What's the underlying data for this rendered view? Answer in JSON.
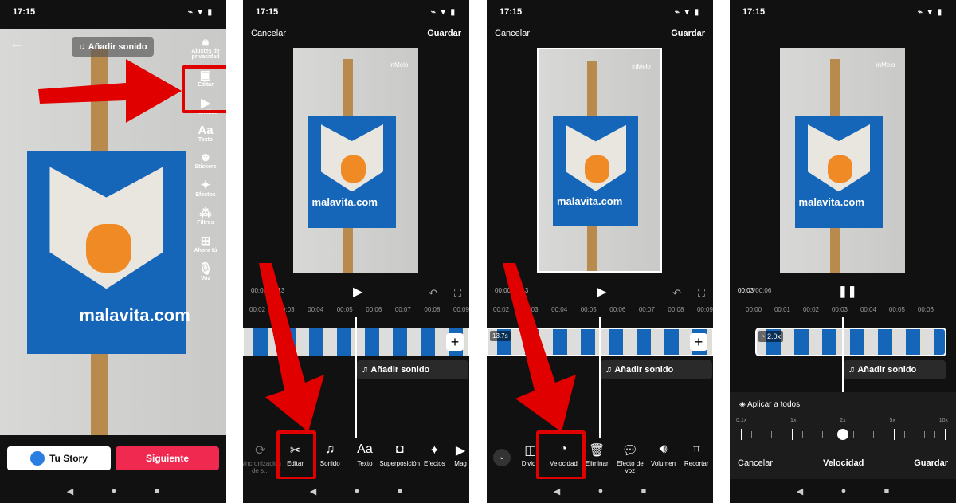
{
  "status": {
    "time": "17:15",
    "icons": "cast wifi battery"
  },
  "nav": {
    "back": "◀",
    "home": "●",
    "recent": "■"
  },
  "screen1": {
    "sound_pill": "Añadir sonido",
    "side_items": [
      {
        "icon": "lock-icon",
        "label": "Ajustes de privacidad"
      },
      {
        "icon": "edit-icon",
        "label": "Editar"
      },
      {
        "icon": "templates-icon",
        "label": "Plantillas"
      },
      {
        "icon": "text-icon",
        "label": "Texto"
      },
      {
        "icon": "stickers-icon",
        "label": "Stickers"
      },
      {
        "icon": "effects-icon",
        "label": "Efectos"
      },
      {
        "icon": "filters-icon",
        "label": "Filtros"
      },
      {
        "icon": "now-icon",
        "label": "Ahora tú"
      },
      {
        "icon": "voice-icon",
        "label": "Voz"
      }
    ],
    "story_button": "Tu Story",
    "next_button": "Siguiente",
    "watermark": "inMelo",
    "url_text": "malavita.com"
  },
  "editor": {
    "cancel": "Cancelar",
    "save": "Guardar",
    "time": "00:00/00:13",
    "ticks2": [
      "00:02",
      "00:03",
      "00:04",
      "00:05",
      "00:06",
      "00:07",
      "00:08",
      "00:09"
    ],
    "sound": "Añadir sonido",
    "clip_duration": "13.7s"
  },
  "screen2": {
    "tools": [
      {
        "icon": "sync-icon",
        "label": "Sincronización de s..."
      },
      {
        "icon": "scissors-icon",
        "label": "Editar"
      },
      {
        "icon": "music-icon",
        "label": "Sonido"
      },
      {
        "icon": "text-icon",
        "label": "Texto"
      },
      {
        "icon": "overlay-icon",
        "label": "Superposición"
      },
      {
        "icon": "effects-icon",
        "label": "Efectos"
      },
      {
        "icon": "magic-icon",
        "label": "Mag"
      }
    ]
  },
  "screen3": {
    "tools": [
      {
        "icon": "split-icon",
        "label": "Dividir"
      },
      {
        "icon": "speed-icon",
        "label": "Velocidad"
      },
      {
        "icon": "trash-icon",
        "label": "Eliminar"
      },
      {
        "icon": "voice-effect-icon",
        "label": "Efecto de voz"
      },
      {
        "icon": "volume-icon",
        "label": "Volumen"
      },
      {
        "icon": "crop-icon",
        "label": "Recortar"
      }
    ]
  },
  "screen4": {
    "time_current": "00:03",
    "time_total": "/00:06",
    "ticks": [
      "00:00",
      "00:01",
      "00:02",
      "00:03",
      "00:04",
      "00:05",
      "00:06"
    ],
    "speed_badge": "2.0x",
    "apply_all": "Aplicar a todos",
    "speed_labels": [
      "0.1x",
      "1x",
      "2x",
      "5x",
      "10x"
    ],
    "speed_value": "2x",
    "cancel": "Cancelar",
    "title": "Velocidad",
    "save": "Guardar"
  },
  "colors": {
    "highlight": "#e10000",
    "next_button": "#ef2950"
  }
}
